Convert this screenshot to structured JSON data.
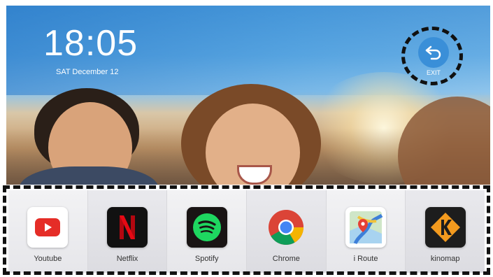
{
  "clock": {
    "time": "18:05",
    "date": "SAT December 12"
  },
  "exit": {
    "label": "EXIT",
    "icon": "back-arrow-icon"
  },
  "apps": [
    {
      "label": "Youtube",
      "icon": "youtube-icon",
      "color": "#e52d27"
    },
    {
      "label": "Netflix",
      "icon": "netflix-icon",
      "color": "#e50914"
    },
    {
      "label": "Spotify",
      "icon": "spotify-icon",
      "color": "#1ed760"
    },
    {
      "label": "Chrome",
      "icon": "chrome-icon",
      "color": "#4285f4"
    },
    {
      "label": "i Route",
      "icon": "map-route-icon",
      "color": "#2f7de1"
    },
    {
      "label": "kinomap",
      "icon": "kinomap-icon",
      "color": "#f39a1e"
    }
  ],
  "colors": {
    "accent": "#3a8fd8",
    "annotation": "#111111"
  }
}
